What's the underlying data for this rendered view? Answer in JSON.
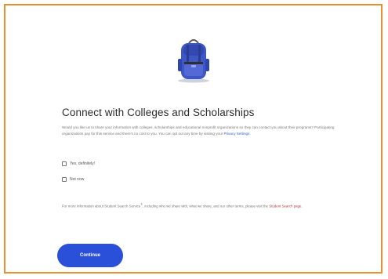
{
  "page": {
    "title": "Connect with Colleges and Scholarships",
    "body_part1": "Would you like us to share your information with colleges, scholarships and educational nonprofit organizations so they can contact you about their programs? Participating organizations pay for this service and there's no cost to you. You can opt out any time by visiting your ",
    "body_link": "Privacy Settings",
    "body_end": "."
  },
  "options": {
    "yes_label": "Yes, definitely!",
    "no_label": "Not now"
  },
  "footnote": {
    "part1": "For more information about Student Search Service",
    "trademark": "®",
    "part2": ", including who we share with, what we share, and our other terms, please visit the ",
    "link": "Student Search page",
    "end": "."
  },
  "actions": {
    "continue_label": "Continue"
  },
  "colors": {
    "frame_border": "#e8912f",
    "primary": "#2a4fd9",
    "backpack": "#3e57c7",
    "link": "#2a5fd6"
  },
  "icons": {
    "illustration": "backpack-illustration"
  }
}
